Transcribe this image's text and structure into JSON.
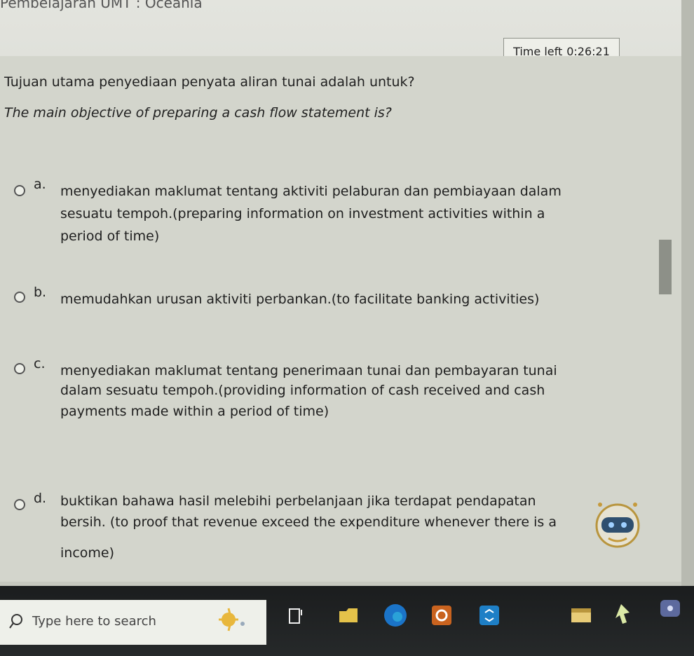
{
  "header": {
    "course_title": "Pembelajaran UMT : Oceania",
    "time_left_label": "Time left",
    "time_left_value": "0:26:21"
  },
  "question": {
    "malay": "Tujuan utama penyediaan penyata aliran tunai adalah untuk?",
    "english": "The main objective of preparing a cash flow statement is?"
  },
  "options": [
    {
      "letter": "a.",
      "lines": [
        "menyediakan maklumat tentang aktiviti pelaburan dan pembiayaan dalam",
        "sesuatu tempoh.(preparing information on investment activities within a",
        "period of time)"
      ]
    },
    {
      "letter": "b.",
      "lines": [
        "memudahkan urusan aktiviti perbankan.(to facilitate banking activities)"
      ]
    },
    {
      "letter": "c.",
      "lines": [
        "menyediakan maklumat tentang penerimaan tunai dan pembayaran tunai",
        "dalam sesuatu tempoh.(providing information of cash received and cash",
        "payments made within a period of time)"
      ]
    },
    {
      "letter": "d.",
      "lines": [
        "buktikan bahawa hasil melebihi perbelanjaan jika terdapat pendapatan",
        "bersih. (to proof that revenue exceed the expenditure whenever there is a",
        "income)"
      ]
    }
  ],
  "taskbar": {
    "search_placeholder": "Type here to search",
    "icons": [
      "weather-icon",
      "task-view-icon",
      "file-explorer-icon",
      "edge-icon",
      "office-icon",
      "app-icon",
      "store-icon",
      "cursor-app-icon",
      "notification-icon"
    ]
  },
  "colors": {
    "accent_blue": "#1b74c8",
    "taskbar": "#1b1d1e"
  }
}
